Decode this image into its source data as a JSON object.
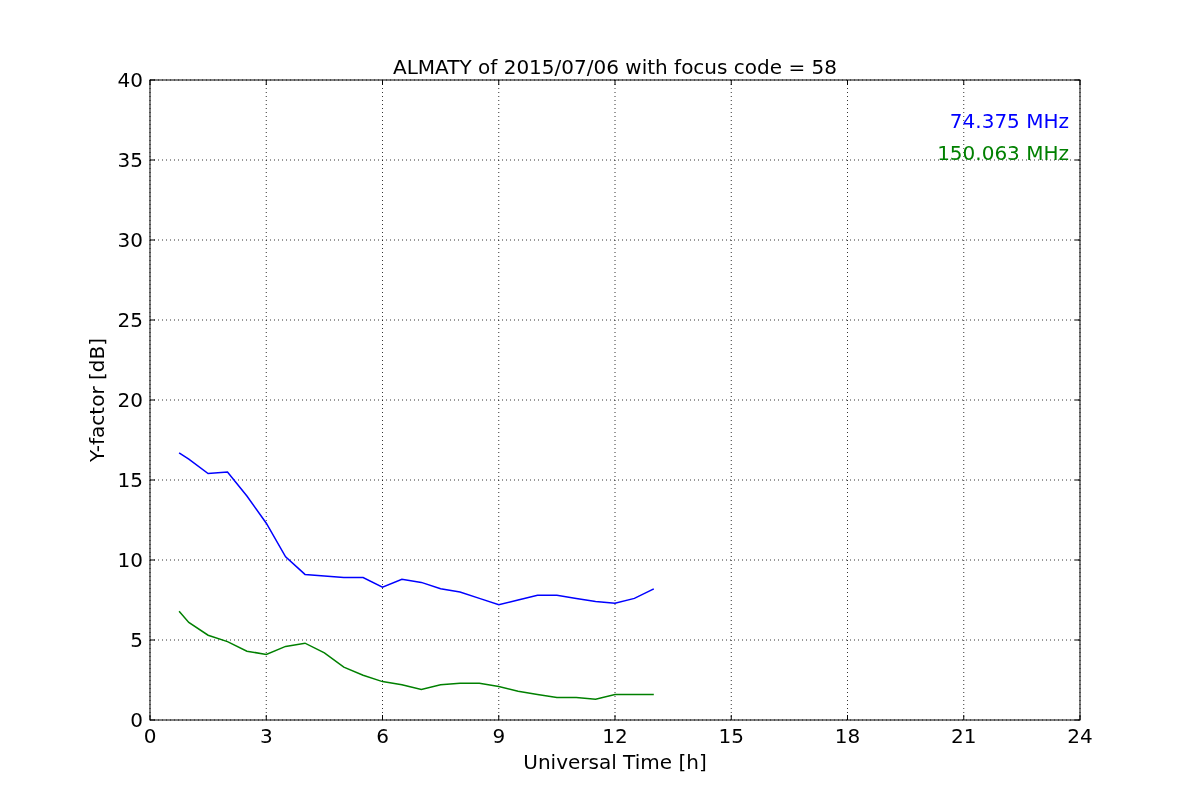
{
  "figure": {
    "chart_data": {
      "type": "line",
      "title": "ALMATY of 2015/07/06 with focus code = 58",
      "xlabel": "Universal Time [h]",
      "ylabel": "Y-factor [dB]",
      "x": [
        0.75,
        1,
        1.5,
        2,
        2.5,
        3,
        3.5,
        4,
        4.5,
        5,
        5.5,
        6,
        6.5,
        7,
        7.5,
        8,
        8.5,
        9,
        9.5,
        10,
        10.5,
        11,
        11.5,
        12,
        12.5,
        13
      ],
      "series": [
        {
          "name": "74.375 MHz",
          "color": "#0000ff",
          "values": [
            16.7,
            16.3,
            15.4,
            15.5,
            14,
            12.3,
            10.2,
            9.1,
            9,
            8.9,
            8.9,
            8.3,
            8.8,
            8.6,
            8.2,
            8,
            7.6,
            7.2,
            7.5,
            7.8,
            7.8,
            7.6,
            7.4,
            7.3,
            7.6,
            8.2
          ]
        },
        {
          "name": "150.063 MHz",
          "color": "#008000",
          "values": [
            6.8,
            6.1,
            5.3,
            4.9,
            4.3,
            4.1,
            4.6,
            4.8,
            4.2,
            3.3,
            2.8,
            2.4,
            2.2,
            1.9,
            2.2,
            2.3,
            2.3,
            2.1,
            1.8,
            1.6,
            1.4,
            1.4,
            1.3,
            1.6,
            1.6,
            1.6
          ]
        }
      ],
      "grid": true,
      "xlim": [
        0,
        24
      ],
      "ylim": [
        0,
        40
      ],
      "xticks": [
        0,
        3,
        6,
        9,
        12,
        15,
        18,
        21,
        24
      ],
      "yticks": [
        0,
        5,
        10,
        15,
        20,
        25,
        30,
        35,
        40
      ]
    }
  }
}
